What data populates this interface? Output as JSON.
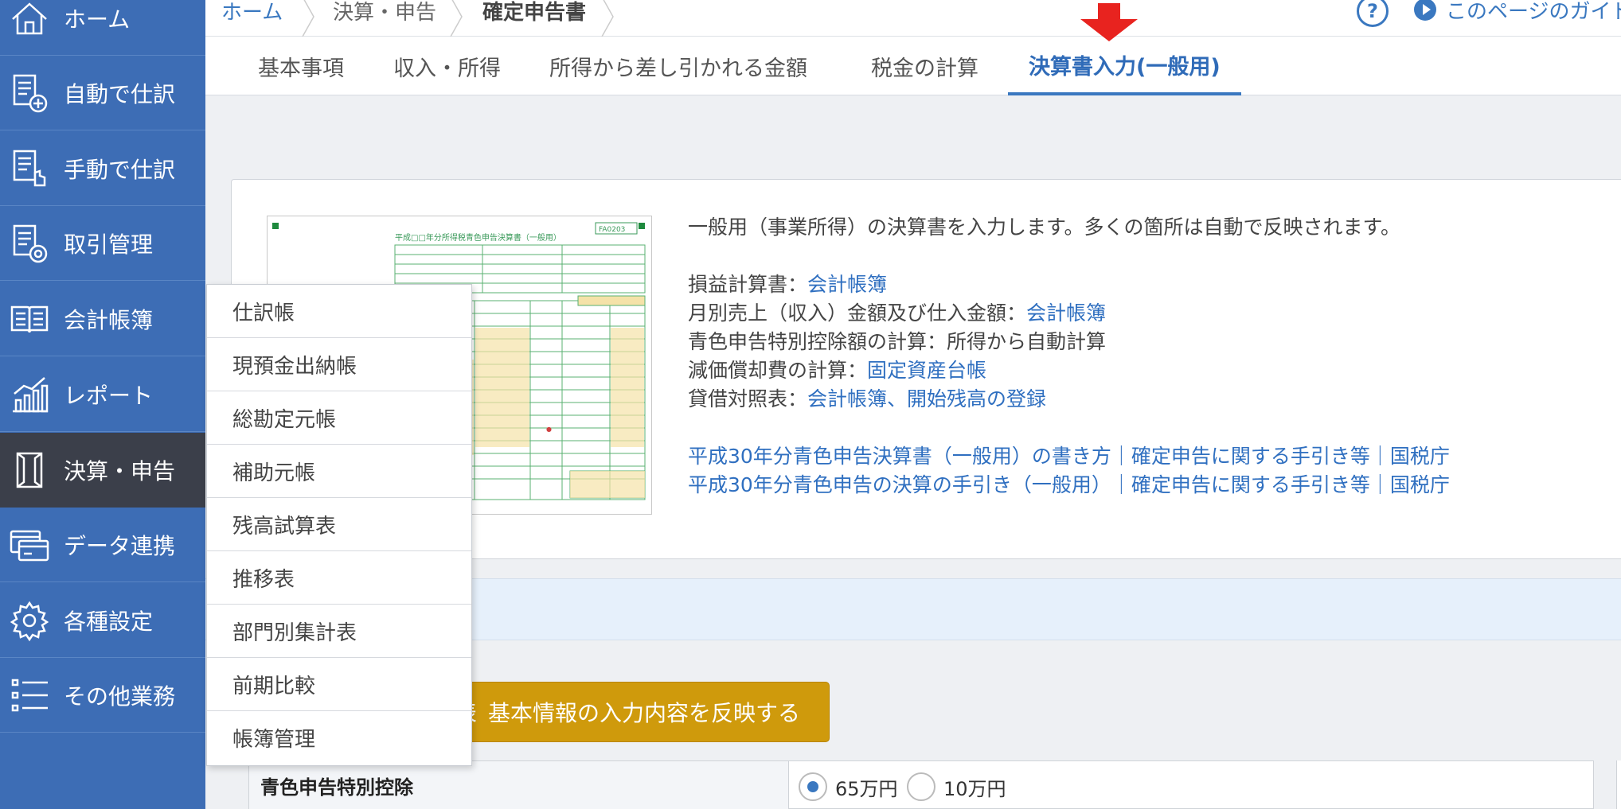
{
  "sidebar": {
    "items": [
      {
        "label": "ホーム",
        "icon": "home-icon"
      },
      {
        "label": "自動で仕訳",
        "icon": "auto-journal-icon"
      },
      {
        "label": "手動で仕訳",
        "icon": "manual-journal-icon"
      },
      {
        "label": "取引管理",
        "icon": "transaction-icon"
      },
      {
        "label": "会計帳簿",
        "icon": "ledger-book-icon"
      },
      {
        "label": "レポート",
        "icon": "report-chart-icon"
      },
      {
        "label": "決算・申告",
        "icon": "settlement-icon",
        "active": true
      },
      {
        "label": "データ連携",
        "icon": "data-link-icon"
      },
      {
        "label": "各種設定",
        "icon": "gear-icon"
      },
      {
        "label": "その他業務",
        "icon": "list-icon"
      }
    ]
  },
  "breadcrumb": {
    "home": "ホーム",
    "section": "決算・申告",
    "current": "確定申告書"
  },
  "header": {
    "help": "?",
    "guide_link": "このページのガイド"
  },
  "tabs": [
    {
      "label": "基本事項"
    },
    {
      "label": "収入・所得"
    },
    {
      "label": "所得から差し引かれる金額"
    },
    {
      "label": "税金の計算"
    },
    {
      "label": "決算書入力(一般用)",
      "active": true
    }
  ],
  "info": {
    "intro": "一般用（事業所得）の決算書を入力します。多くの箇所は自動で反映されます。",
    "pl_label": "損益計算書：",
    "pl_link": "会計帳簿",
    "monthly_label": "月別売上（収入）金額及び仕入金額：",
    "monthly_link": "会計帳簿",
    "deduction_text": "青色申告特別控除額の計算：所得から自動計算",
    "depreciation_label": "減価償却費の計算：",
    "depreciation_link": "固定資産台帳",
    "bs_label": "貸借対照表：",
    "bs_link": "会計帳簿、開始残高の登録",
    "guide_link_1": "平成30年分青色申告決算書（一般用）の書き方｜確定申告に関する手引き等｜国税庁",
    "guide_link_2": "平成30年分青色申告の決算の手引き（一般用）｜確定申告に関する手引き等｜国税庁"
  },
  "form_thumbnail": {
    "header_text": "平成□□年分所得税青色申告決算書（一般用）",
    "code": "FA0203"
  },
  "apply_button": "基本情報の入力内容を反映する",
  "apply_button_prefix": "表",
  "form": {
    "label": "青色申告特別控除",
    "options": [
      {
        "label": "65万円",
        "selected": true
      },
      {
        "label": "10万円",
        "selected": false
      }
    ]
  },
  "dropdown": {
    "items": [
      "仕訳帳",
      "現預金出納帳",
      "総勘定元帳",
      "補助元帳",
      "残高試算表",
      "推移表",
      "部門別集計表",
      "前期比較",
      "帳簿管理"
    ]
  },
  "colors": {
    "sidebar_bg": "#3d6db5",
    "sidebar_active": "#3b3f4a",
    "link": "#2f6fc0",
    "apply_button": "#cf9a0c",
    "arrow": "#e8231f"
  }
}
